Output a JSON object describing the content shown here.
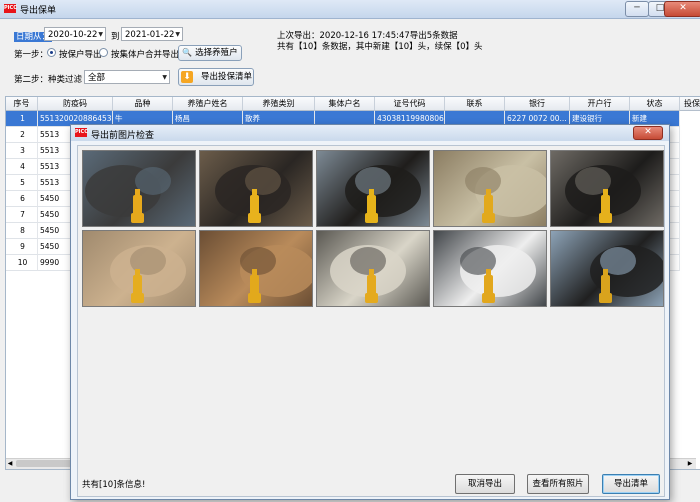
{
  "window": {
    "title": "导出保单",
    "app_icon_text": "PICC"
  },
  "filters": {
    "date_from_label": "日期从：",
    "date_from": "2020-10-22",
    "date_to_label": "到",
    "date_to": "2021-01-22",
    "step1_label": "第一步：",
    "radio_by_household": "按保户导出",
    "radio_merge_collective": "按集体户合并导出",
    "select_farmer_button": "选择养殖户",
    "step2_label": "第二步：种类过滤",
    "species_select": "全部",
    "export_list_button": "导出投保清单"
  },
  "last_export": {
    "line1": "上次导出：2020-12-16 17:45:47导出5条数据",
    "line2": "共有【10】条数据，其中新建【10】头，续保【0】头"
  },
  "table": {
    "columns": [
      "序号",
      "防疫码",
      "品种",
      "养殖户姓名",
      "养殖类别",
      "集体户名",
      "证号代码",
      "联系",
      "银行",
      "开户行",
      "状态",
      "投保"
    ],
    "rows": [
      {
        "no": "1",
        "code": "551320020886453",
        "breed": "牛",
        "owner": "杨昌",
        "type": "散养",
        "collective": "",
        "id": "43038119980806...",
        "contact": "",
        "bank": "6227 0072 00...",
        "branch": "建设银行",
        "status": "新建"
      },
      {
        "no": "2",
        "code": "5513",
        "breed": "",
        "owner": "",
        "type": "",
        "collective": "",
        "id": "",
        "contact": "",
        "bank": "6227 0072 00...",
        "branch": "建设银行",
        "status": "新建"
      },
      {
        "no": "3",
        "code": "5513",
        "breed": "",
        "owner": "",
        "type": "",
        "collective": "",
        "id": "",
        "contact": "",
        "bank": "",
        "branch": "",
        "status": ""
      },
      {
        "no": "4",
        "code": "5513",
        "breed": "",
        "owner": "",
        "type": "",
        "collective": "",
        "id": "",
        "contact": "",
        "bank": "",
        "branch": "",
        "status": ""
      },
      {
        "no": "5",
        "code": "5513",
        "breed": "",
        "owner": "",
        "type": "",
        "collective": "",
        "id": "",
        "contact": "",
        "bank": "",
        "branch": "",
        "status": ""
      },
      {
        "no": "6",
        "code": "5450",
        "breed": "",
        "owner": "",
        "type": "",
        "collective": "",
        "id": "",
        "contact": "",
        "bank": "",
        "branch": "",
        "status": ""
      },
      {
        "no": "7",
        "code": "5450",
        "breed": "",
        "owner": "",
        "type": "",
        "collective": "",
        "id": "",
        "contact": "",
        "bank": "",
        "branch": "",
        "status": ""
      },
      {
        "no": "8",
        "code": "5450",
        "breed": "",
        "owner": "",
        "type": "",
        "collective": "",
        "id": "",
        "contact": "",
        "bank": "",
        "branch": "",
        "status": ""
      },
      {
        "no": "9",
        "code": "5450",
        "breed": "",
        "owner": "",
        "type": "",
        "collective": "",
        "id": "",
        "contact": "",
        "bank": "",
        "branch": "",
        "status": ""
      },
      {
        "no": "10",
        "code": "9990",
        "breed": "",
        "owner": "",
        "type": "",
        "collective": "",
        "id": "",
        "contact": "",
        "bank": "",
        "branch": "",
        "status": ""
      }
    ]
  },
  "dialog": {
    "title": "导出前图片检查",
    "app_icon_text": "PICC",
    "footer_count": "共有[10]条信息!",
    "cancel_button": "取消导出",
    "view_all_button": "查看所有照片",
    "export_button": "导出清单",
    "photos": [
      {
        "label": "cattle-photo-1",
        "colors": [
          "#5a6a78",
          "#3b3b3b",
          "#e7a91c"
        ]
      },
      {
        "label": "cattle-photo-2",
        "colors": [
          "#6b5c4a",
          "#2a2623",
          "#e8b21d"
        ]
      },
      {
        "label": "cattle-photo-3",
        "colors": [
          "#7d8a95",
          "#1f1d1b",
          "#e6b31a"
        ]
      },
      {
        "label": "cattle-photo-4",
        "colors": [
          "#8b7d62",
          "#c9c0a5",
          "#e2a91d"
        ]
      },
      {
        "label": "cattle-photo-5",
        "colors": [
          "#6e6a64",
          "#1d1c1b",
          "#e6b11c"
        ]
      },
      {
        "label": "cattle-photo-6",
        "colors": [
          "#a08a6e",
          "#cdb28f",
          "#e5ad20"
        ]
      },
      {
        "label": "cattle-photo-7",
        "colors": [
          "#6b4e34",
          "#b98b5b",
          "#e2a91c"
        ]
      },
      {
        "label": "cattle-photo-8",
        "colors": [
          "#5b5953",
          "#d9d5c8",
          "#e4aa1f"
        ]
      },
      {
        "label": "cattle-photo-9",
        "colors": [
          "#42464a",
          "#eeeeee",
          "#e2a71d"
        ]
      },
      {
        "label": "cattle-photo-10",
        "colors": [
          "#8da3b7",
          "#202020",
          "#d9a31d"
        ]
      }
    ]
  },
  "colors": {
    "selection": "#3a78d4",
    "accent_orange": "#f5a623"
  }
}
